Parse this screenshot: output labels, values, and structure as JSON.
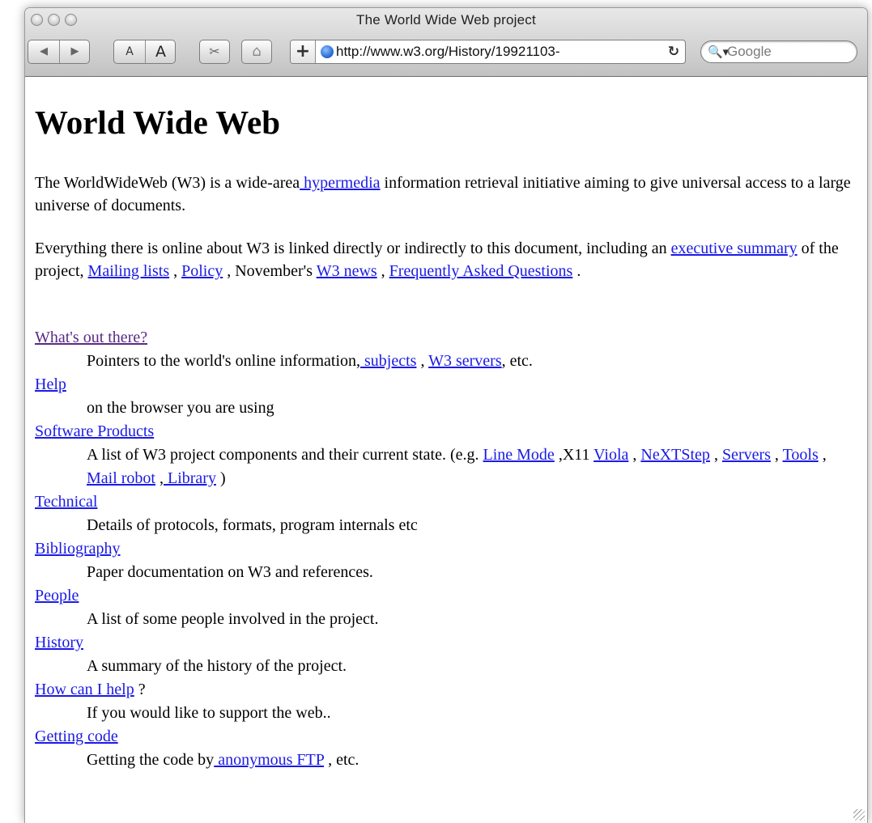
{
  "window": {
    "title": "The World Wide Web project"
  },
  "toolbar": {
    "back_icon": "◀",
    "forward_icon": "▶",
    "text_smaller": "A",
    "text_bigger": "A",
    "snippet_icon": "✂",
    "home_icon": "⌂",
    "add_bookmark": "+",
    "url": "http://www.w3.org/History/19921103-",
    "reload_icon": "↻",
    "search_icon": "🔍▾",
    "search_placeholder": "Google"
  },
  "page": {
    "heading": "World Wide Web",
    "intro": {
      "pre": "The WorldWideWeb (W3) is a wide-area",
      "link": " hypermedia",
      "post": " information retrieval initiative aiming to give universal access to a large universe of documents."
    },
    "overview": {
      "t1": "Everything there is online about W3 is linked directly or indirectly to this document, including an ",
      "l_summary": "executive summary",
      "t2": " of the project, ",
      "l_mailing": "Mailing lists",
      "t3": " , ",
      "l_policy": "Policy",
      "t4": " , November's ",
      "l_news": "W3 news",
      "t5": " , ",
      "l_faq": "Frequently Asked Questions",
      "t6": " ."
    },
    "items": {
      "whats_out": {
        "term": "What's out there?",
        "desc_pre": "Pointers to the world's online information,",
        "l_subjects": " subjects",
        "sep1": " , ",
        "l_servers": "W3 servers",
        "desc_post": ", etc."
      },
      "help": {
        "term": "Help",
        "desc": "on the browser you are using"
      },
      "software": {
        "term": "Software Products",
        "desc_pre": "A list of W3 project components and their current state. (e.g. ",
        "l_linemode": "Line Mode",
        "t_x11": " ,X11 ",
        "l_viola": "Viola",
        "s1": " , ",
        "l_next": "NeXTStep",
        "s2": " , ",
        "l_servers": "Servers",
        "s3": " , ",
        "l_tools": "Tools",
        "s4": " ,",
        "l_mail": " Mail robot",
        "s5": " ,",
        "l_library": " Library",
        "end": " )"
      },
      "technical": {
        "term": "Technical",
        "desc": "Details of protocols, formats, program internals etc"
      },
      "bibliography": {
        "term": "Bibliography",
        "desc": "Paper documentation on W3 and references."
      },
      "people": {
        "term": "People",
        "desc": "A list of some people involved in the project."
      },
      "history": {
        "term": "History",
        "desc": "A summary of the history of the project."
      },
      "howhelp": {
        "term": "How can I help",
        "term_suffix": " ?",
        "desc": "If you would like to support the web.."
      },
      "getting": {
        "term": "Getting code",
        "desc_pre": "Getting the code by",
        "l_ftp": " anonymous FTP",
        "desc_post": " , etc."
      }
    }
  },
  "colors": {
    "link": "#1a1ae6",
    "visited_link": "#5a2a86"
  }
}
